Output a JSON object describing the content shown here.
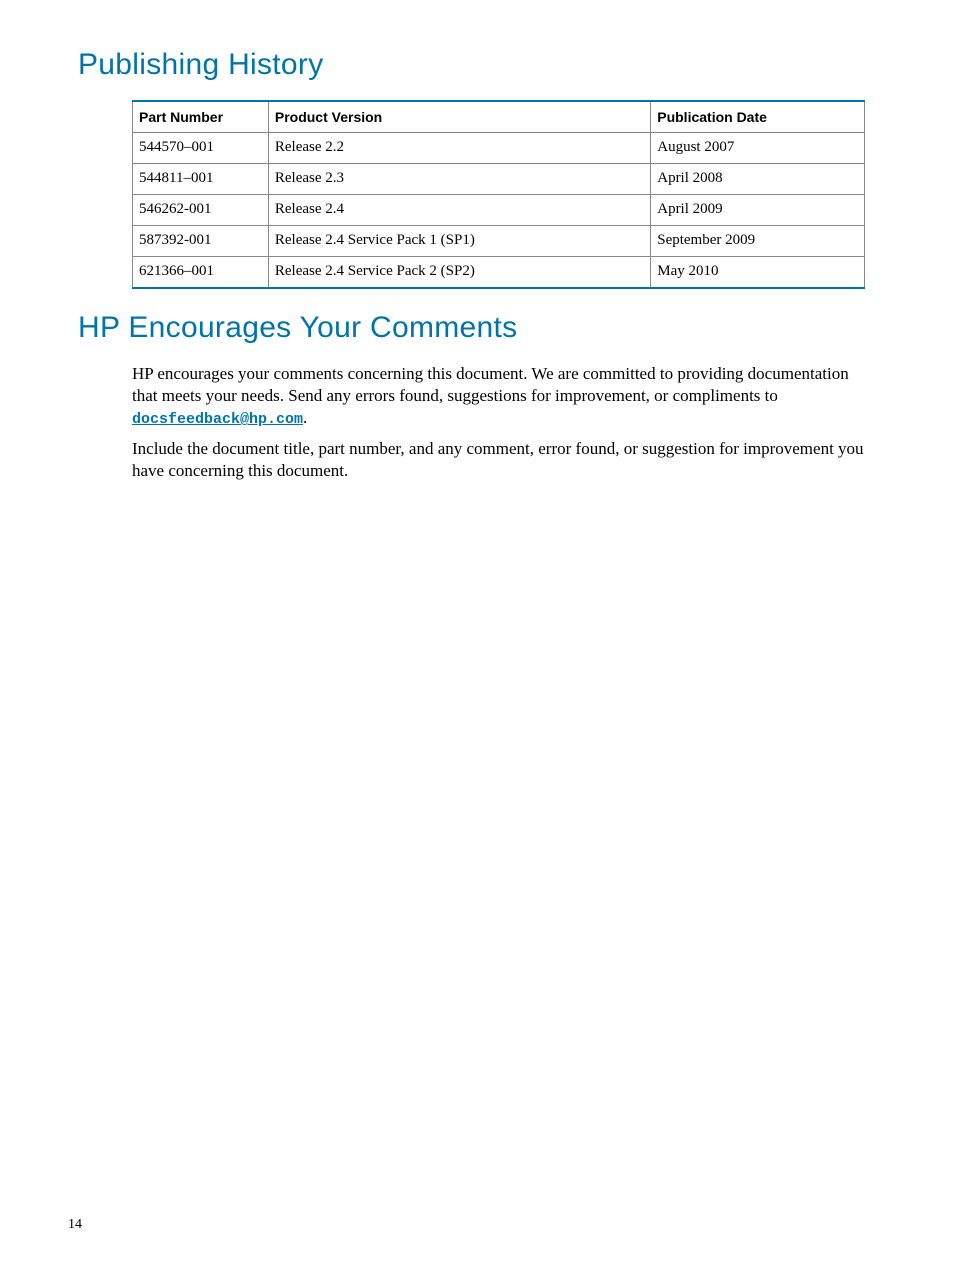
{
  "headings": {
    "publishing_history": "Publishing History",
    "hp_encourages": "HP Encourages Your Comments"
  },
  "table": {
    "headers": {
      "part_number": "Part Number",
      "product_version": "Product Version",
      "publication_date": "Publication Date"
    },
    "rows": [
      {
        "part_number": "544570–001",
        "product_version": "Release 2.2",
        "publication_date": "August 2007"
      },
      {
        "part_number": "544811–001",
        "product_version": "Release 2.3",
        "publication_date": "April 2008"
      },
      {
        "part_number": "546262-001",
        "product_version": "Release 2.4",
        "publication_date": "April 2009"
      },
      {
        "part_number": "587392-001",
        "product_version": "Release 2.4 Service Pack 1 (SP1)",
        "publication_date": "September 2009"
      },
      {
        "part_number": "621366–001",
        "product_version": "Release 2.4 Service Pack 2 (SP2)",
        "publication_date": "May 2010"
      }
    ]
  },
  "paragraphs": {
    "p1_before": "HP encourages your comments concerning this document. We are committed to providing documentation that meets your needs. Send any errors found, suggestions for improvement, or compliments to ",
    "p1_link": "docsfeedback@hp.com",
    "p1_after": ".",
    "p2": "Include the document title, part number, and any comment, error found, or suggestion for improvement you have concerning this document."
  },
  "page_number": "14"
}
